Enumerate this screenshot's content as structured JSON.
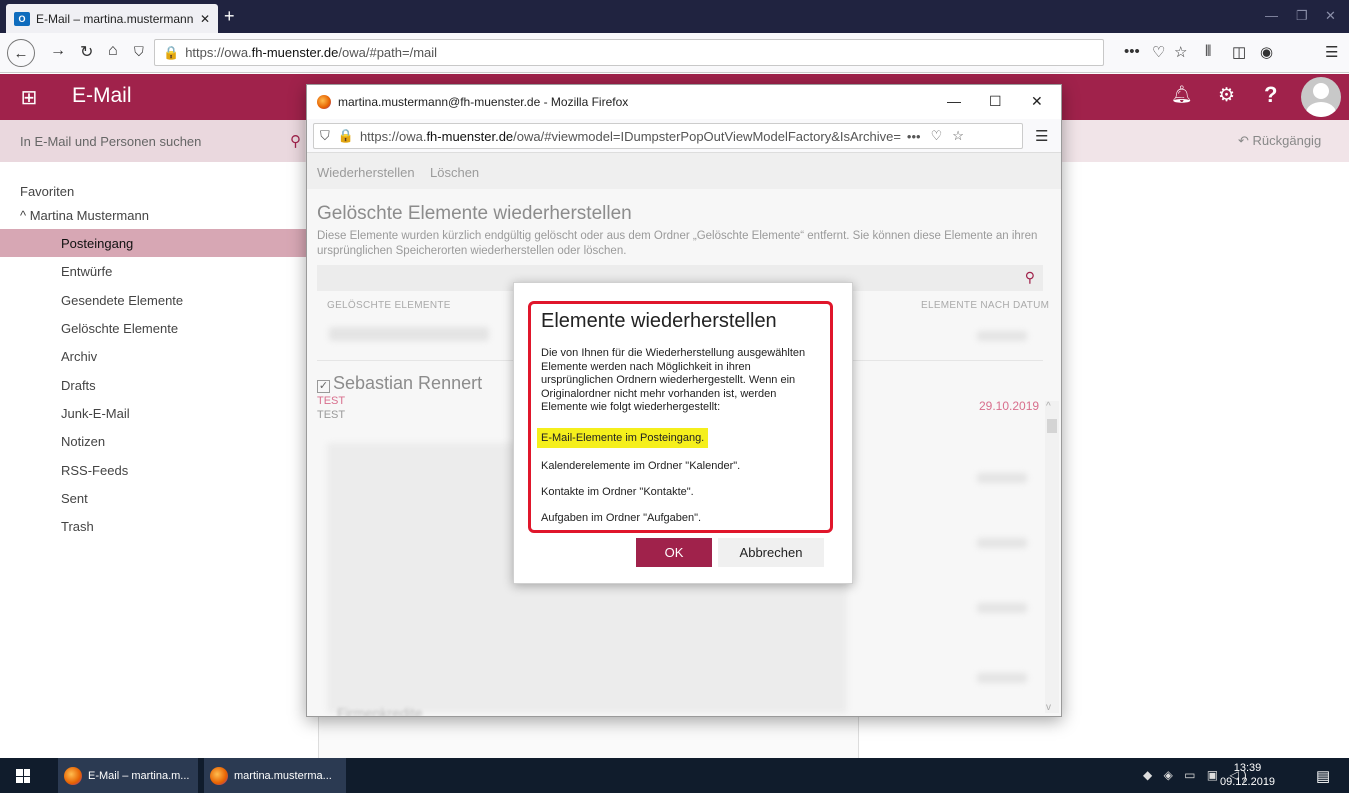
{
  "browser": {
    "tab_title": "E-Mail – martina.mustermann@",
    "tab_icon": "O",
    "url_prefix": "https://owa.",
    "url_domain": "fh-muenster.de",
    "url_path": "/owa/#path=/mail"
  },
  "owa": {
    "app_title": "E-Mail",
    "search_placeholder": "In E-Mail und Personen suchen",
    "undo_label": "Rückgängig",
    "favorites": "Favoriten",
    "account": "Martina Mustermann",
    "folders": [
      {
        "label": "Posteingang"
      },
      {
        "label": "Entwürfe"
      },
      {
        "label": "Gesendete Elemente"
      },
      {
        "label": "Gelöschte Elemente"
      },
      {
        "label": "Archiv"
      },
      {
        "label": "Drafts"
      },
      {
        "label": "Junk-E-Mail"
      },
      {
        "label": "Notizen"
      },
      {
        "label": "RSS-Feeds"
      },
      {
        "label": "Sent"
      },
      {
        "label": "Trash"
      }
    ]
  },
  "popup": {
    "window_title": "martina.mustermann@fh-muenster.de - Mozilla Firefox",
    "url_prefix": "https://owa.",
    "url_domain": "fh-muenster.de",
    "url_path": "/owa/#viewmodel=IDumpsterPopOutViewModelFactory&IsArchive=",
    "toolbar": {
      "restore": "Wiederherstellen",
      "delete": "Löschen"
    },
    "heading": "Gelöschte Elemente wiederherstellen",
    "description": "Diese Elemente wurden kürzlich endgültig gelöscht oder aus dem Ordner „Gelöschte Elemente“ entfernt. Sie können diese Elemente an ihren ursprünglichen Speicherorten wiederherstellen oder löschen.",
    "col_left": "GELÖSCHTE ELEMENTE",
    "col_right": "ELEMENTE NACH DATUM",
    "sender": "Sebastian Rennert",
    "subject1": "TEST",
    "subject2": "TEST",
    "date": "29.10.2019",
    "bottom_blur": "Firmenkredite"
  },
  "dialog": {
    "title": "Elemente wiederherstellen",
    "text": "Die von Ihnen für die Wiederherstellung ausgewählten Elemente werden nach Möglichkeit in ihren ursprünglichen Ordnern wiederhergestellt. Wenn ein Originalordner nicht mehr vorhanden ist, werden Elemente wie folgt wiederhergestellt:",
    "line_mail": "E-Mail-Elemente im Posteingang.",
    "line_calendar": "Kalenderelemente im Ordner \"Kalender\".",
    "line_contacts": "Kontakte im Ordner \"Kontakte\".",
    "line_tasks": "Aufgaben im Ordner \"Aufgaben\".",
    "ok": "OK",
    "cancel": "Abbrechen",
    "highlight_color": "#f5ef1c",
    "frame_color": "#e0162b"
  },
  "taskbar": {
    "item1": "E-Mail – martina.m...",
    "item2": "martina.musterma...",
    "time": "13:39",
    "date": "09.12.2019"
  },
  "colors": {
    "brand": "#a0224b"
  }
}
